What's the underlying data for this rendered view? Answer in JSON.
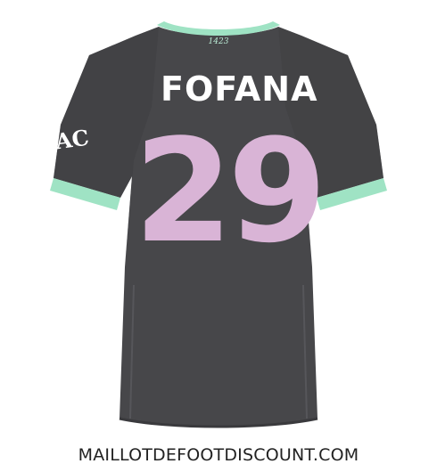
{
  "product": {
    "player_name": "FOFANA",
    "player_number": "29",
    "collar_mark": "1423",
    "sleeve_mark": "AC"
  },
  "colors": {
    "shirt": "#47474a",
    "trim": "#9fe3c4",
    "number": "#d9b4d6",
    "name": "#ffffff"
  },
  "watermark": {
    "text": "MAILLOTDEFOOTDISCOUNT.COM"
  }
}
